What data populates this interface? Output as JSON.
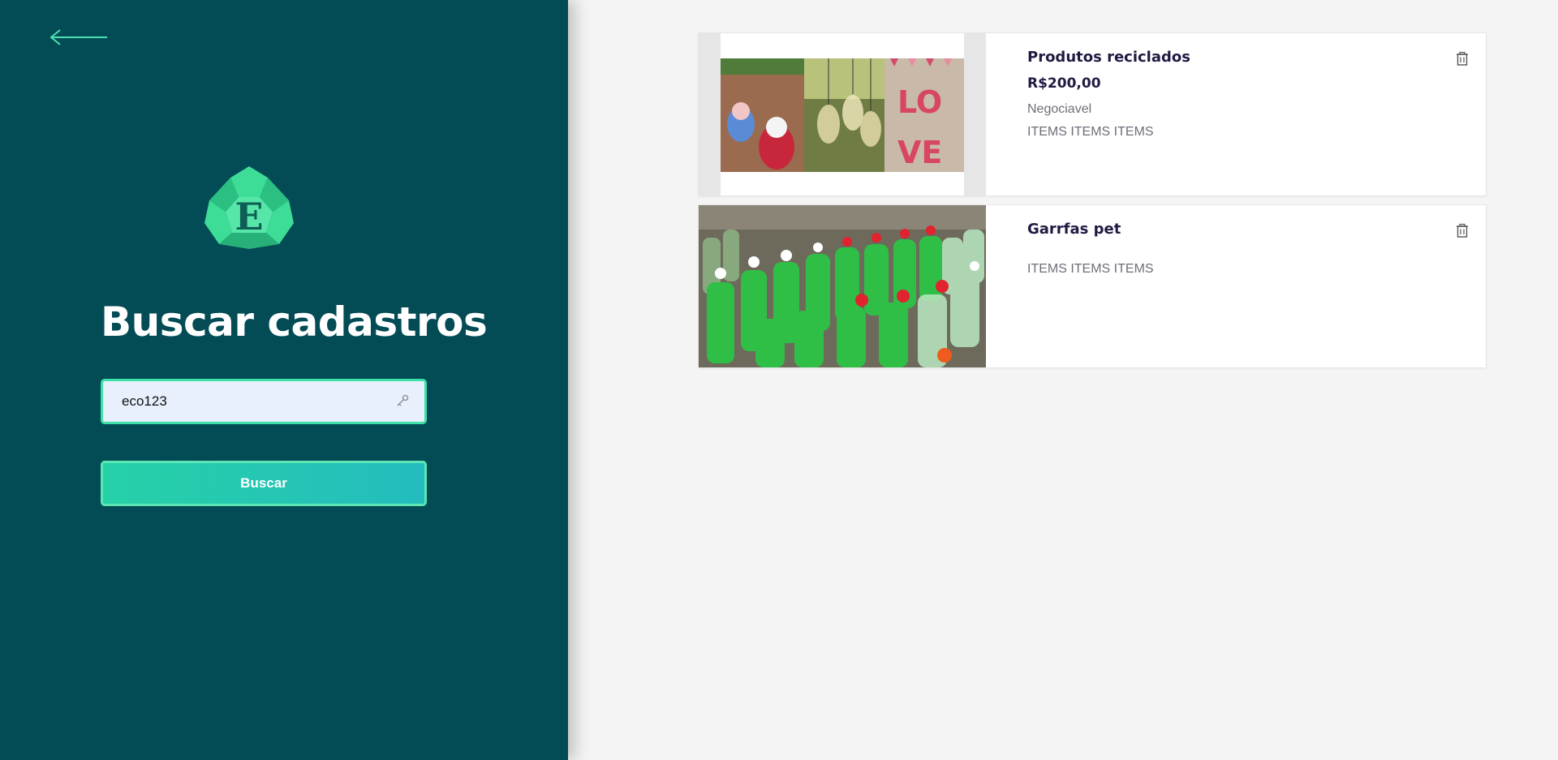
{
  "search": {
    "title": "Buscar cadastros",
    "key_value": "eco123",
    "button_label": "Buscar"
  },
  "icons": {
    "back": "arrow-left-icon",
    "logo": "recycle-e-logo",
    "key": "key-icon",
    "delete": "trash-icon"
  },
  "colors": {
    "sidebar_bg": "#034b55",
    "accent": "#26d1a7",
    "field_border": "#3fe0a8",
    "title_text": "#221a42"
  },
  "results": [
    {
      "name": "Produtos reciclados",
      "price": "R$200,00",
      "negotiable": "Negociavel",
      "items": "ITEMS ITEMS ITEMS"
    },
    {
      "name": "Garrfas pet",
      "items": "ITEMS ITEMS ITEMS"
    }
  ]
}
